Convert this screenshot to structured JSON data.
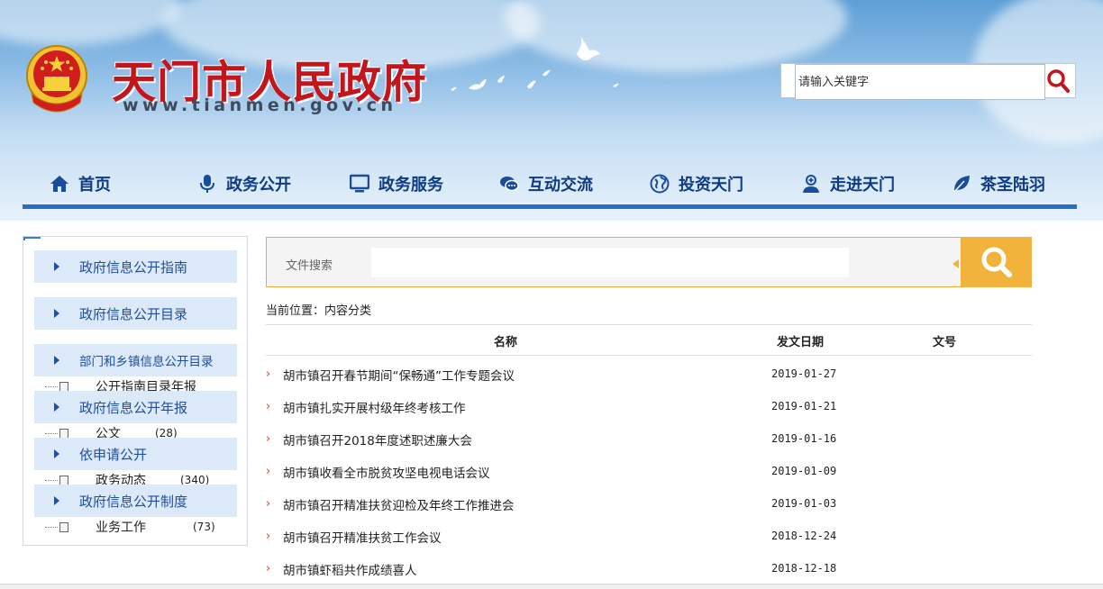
{
  "header": {
    "title": "天门市人民政府",
    "url": "www.tianmen.gov.cn",
    "search_placeholder": "请输入关键字"
  },
  "nav": [
    {
      "label": "首页",
      "icon": "home-icon"
    },
    {
      "label": "政务公开",
      "icon": "microphone-icon"
    },
    {
      "label": "政务服务",
      "icon": "monitor-icon"
    },
    {
      "label": "互动交流",
      "icon": "chat-bubble-icon"
    },
    {
      "label": "投资天门",
      "icon": "globe-icon"
    },
    {
      "label": "走进天门",
      "icon": "user-plus-icon"
    },
    {
      "label": "茶圣陆羽",
      "icon": "leaf-icon"
    }
  ],
  "sidebar": {
    "items": [
      {
        "label": "政府信息公开指南"
      },
      {
        "label": "政府信息公开目录"
      },
      {
        "label": "部门和乡镇信息公开目录"
      },
      {
        "label": "政府信息公开年报"
      },
      {
        "label": "依申请公开"
      },
      {
        "label": "政府信息公开制度"
      }
    ],
    "tree": [
      {
        "label": "公开指南目录年报",
        "count": ""
      },
      {
        "label": "公文",
        "count": "(28)"
      },
      {
        "label": "政务动态",
        "count": "(340)"
      },
      {
        "label": "业务工作",
        "count": "(73)"
      }
    ]
  },
  "file_search": {
    "label": "文件搜索"
  },
  "breadcrumb": "当前位置：内容分类",
  "table": {
    "headers": {
      "name": "名称",
      "date": "发文日期",
      "number": "文号"
    },
    "rows": [
      {
        "title": "胡市镇召开春节期间“保畅通”工作专题会议",
        "date": "2019-01-27"
      },
      {
        "title": "胡市镇扎实开展村级年终考核工作",
        "date": "2019-01-21"
      },
      {
        "title": "胡市镇召开2018年度述职述廉大会",
        "date": "2019-01-16"
      },
      {
        "title": "胡市镇收看全市脱贫攻坚电视电话会议",
        "date": "2019-01-09"
      },
      {
        "title": "胡市镇召开精准扶贫迎检及年终工作推进会",
        "date": "2019-01-03"
      },
      {
        "title": "胡市镇召开精准扶贫工作会议",
        "date": "2018-12-24"
      },
      {
        "title": "胡市镇虾稻共作成绩喜人",
        "date": "2018-12-18"
      }
    ]
  },
  "colors": {
    "title_red": "#c3161c",
    "nav_blue": "#0f3b83",
    "accent_orange": "#f2b33d",
    "arrow_red": "#d3421f"
  }
}
